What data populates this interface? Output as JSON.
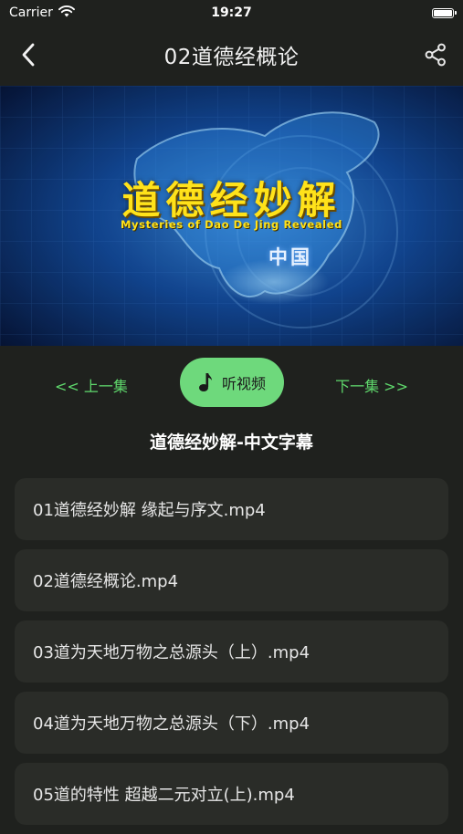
{
  "status_bar": {
    "carrier": "Carrier",
    "time": "19:27"
  },
  "nav": {
    "title": "02道德经概论",
    "back_icon": "chevron-left-icon",
    "share_icon": "share-icon"
  },
  "video": {
    "title": "道德经妙解",
    "subtitle": "Mysteries of Dao De Jing Revealed",
    "country": "中国"
  },
  "controls": {
    "prev_label": "<< 上一集",
    "listen_label": "听视频",
    "next_label": "下一集 >>",
    "listen_icon": "music-note-icon",
    "accent_color": "#6ed97c"
  },
  "section_title": "道德经妙解-中文字幕",
  "episodes": [
    {
      "label": "01道德经妙解 缘起与序文.mp4"
    },
    {
      "label": "02道德经概论.mp4"
    },
    {
      "label": "03道为天地万物之总源头（上）.mp4"
    },
    {
      "label": "04道为天地万物之总源头（下）.mp4"
    },
    {
      "label": "05道的特性 超越二元对立(上).mp4"
    }
  ]
}
